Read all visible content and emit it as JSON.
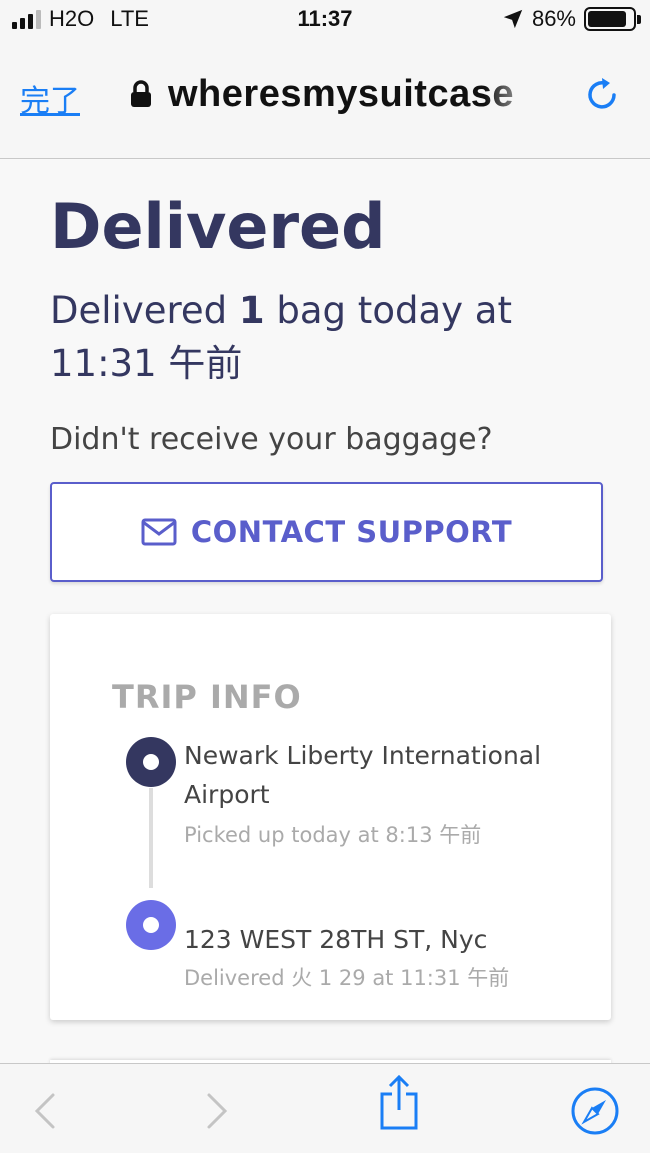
{
  "status_bar": {
    "carrier": "H2O",
    "network": "LTE",
    "time": "11:37",
    "battery": "86%",
    "battery_level": 0.86
  },
  "browser": {
    "done_label": "完了",
    "url": "wheresmysuitcase"
  },
  "page": {
    "title": "Delivered",
    "delivered_prefix": "Delivered ",
    "bag_count": "1",
    "delivered_suffix": " bag today at 11:31 午前",
    "question": "Didn't receive your baggage?",
    "support_label": "CONTACT SUPPORT"
  },
  "trip": {
    "title": "TRIP INFO",
    "origin": {
      "name": "Newark Liberty International Airport",
      "detail": "Picked up today at 8:13 午前"
    },
    "destination": {
      "name": "123 WEST 28TH ST, Nyc",
      "detail": "Delivered 火 1 29 at 11:31 午前"
    }
  },
  "colors": {
    "brand_navy": "#343760",
    "brand_purple": "#5a5ecb",
    "ios_blue": "#1a7ef5"
  }
}
